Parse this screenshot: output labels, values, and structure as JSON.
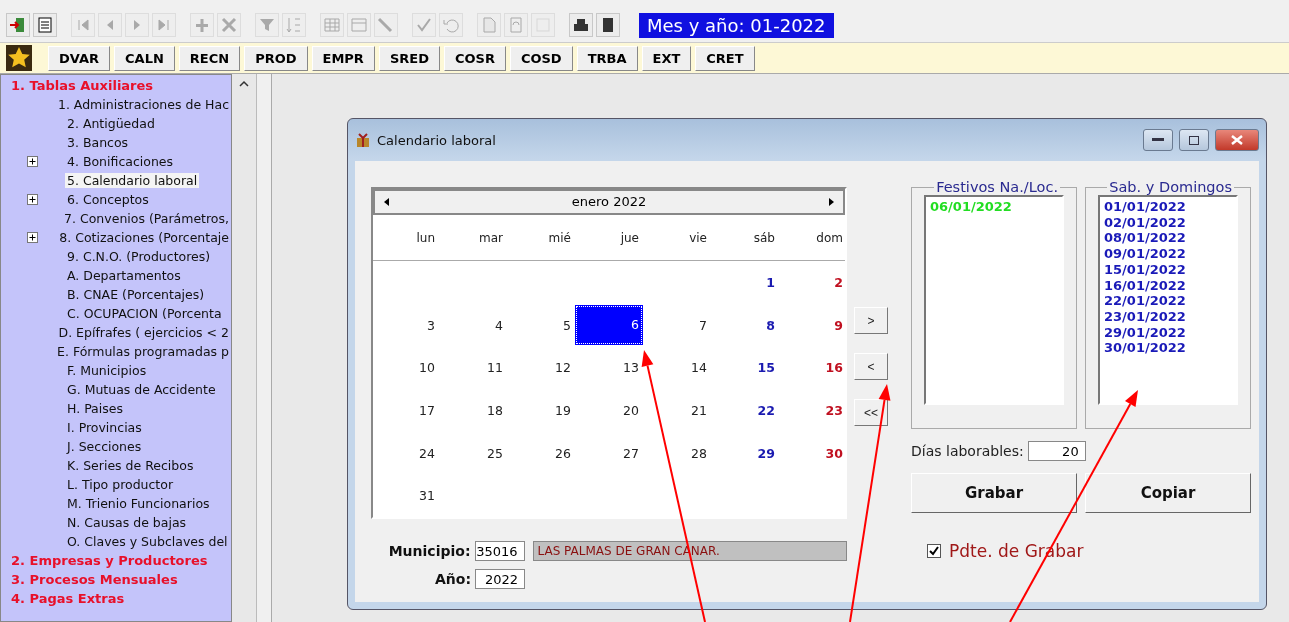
{
  "toolbar": {
    "icons": [
      {
        "kind": "exit",
        "disabled": false
      },
      {
        "kind": "properties",
        "disabled": false
      },
      {
        "kind": "first",
        "disabled": true
      },
      {
        "kind": "prev",
        "disabled": true
      },
      {
        "kind": "next",
        "disabled": true
      },
      {
        "kind": "last",
        "disabled": true
      },
      {
        "kind": "add",
        "disabled": true
      },
      {
        "kind": "delete",
        "disabled": true
      },
      {
        "kind": "filter",
        "disabled": true
      },
      {
        "kind": "sort",
        "disabled": true
      },
      {
        "kind": "grid",
        "disabled": true
      },
      {
        "kind": "form",
        "disabled": true
      },
      {
        "kind": "wand",
        "disabled": true
      },
      {
        "kind": "check",
        "disabled": true
      },
      {
        "kind": "undo",
        "disabled": true
      },
      {
        "kind": "doc",
        "disabled": true
      },
      {
        "kind": "refresh",
        "disabled": true
      },
      {
        "kind": "blank",
        "disabled": true
      },
      {
        "kind": "print",
        "disabled": false
      },
      {
        "kind": "page",
        "disabled": false
      }
    ],
    "period": "Mes y año: 01-2022"
  },
  "shortcuts": [
    "DVAR",
    "CALN",
    "RECN",
    "PROD",
    "EMPR",
    "SRED",
    "COSR",
    "COSD",
    "TRBA",
    "EXT",
    "CRET"
  ],
  "tree": [
    {
      "label": "1. Tablas Auxiliares",
      "children": [
        {
          "label": "1. Administraciones de Hac",
          "expandable": false,
          "selected": false
        },
        {
          "label": "2. Antigüedad",
          "expandable": false,
          "selected": false
        },
        {
          "label": "3. Bancos",
          "expandable": false,
          "selected": false
        },
        {
          "label": "4. Bonificaciones",
          "expandable": true,
          "selected": false
        },
        {
          "label": "5. Calendario laboral",
          "expandable": false,
          "selected": true
        },
        {
          "label": "6. Conceptos",
          "expandable": true,
          "selected": false
        },
        {
          "label": "7. Convenios (Parámetros,",
          "expandable": false,
          "selected": false
        },
        {
          "label": "8. Cotizaciones (Porcentaje",
          "expandable": true,
          "selected": false
        },
        {
          "label": "9. C.N.O. (Productores)",
          "expandable": false,
          "selected": false
        },
        {
          "label": "A. Departamentos",
          "expandable": false,
          "selected": false
        },
        {
          "label": "B. CNAE (Porcentajes)",
          "expandable": false,
          "selected": false
        },
        {
          "label": "C. OCUPACION (Porcenta",
          "expandable": false,
          "selected": false
        },
        {
          "label": "D. Epífrafes ( ejercicios < 2",
          "expandable": false,
          "selected": false
        },
        {
          "label": "E. Fórmulas programadas p",
          "expandable": false,
          "selected": false
        },
        {
          "label": "F. Municipios",
          "expandable": false,
          "selected": false
        },
        {
          "label": "G. Mutuas de Accidente",
          "expandable": false,
          "selected": false
        },
        {
          "label": "H. Paises",
          "expandable": false,
          "selected": false
        },
        {
          "label": "I. Provincias",
          "expandable": false,
          "selected": false
        },
        {
          "label": "J. Secciones",
          "expandable": false,
          "selected": false
        },
        {
          "label": "K. Series de Recibos",
          "expandable": false,
          "selected": false
        },
        {
          "label": "L. Tipo productor",
          "expandable": false,
          "selected": false
        },
        {
          "label": "M. Trienio Funcionarios",
          "expandable": false,
          "selected": false
        },
        {
          "label": "N. Causas de bajas",
          "expandable": false,
          "selected": false
        },
        {
          "label": "O. Claves y Subclaves del",
          "expandable": false,
          "selected": false
        }
      ]
    },
    {
      "label": "2. Empresas y Productores"
    },
    {
      "label": "3. Procesos Mensuales"
    },
    {
      "label": "4. Pagas Extras"
    }
  ],
  "dialog": {
    "title": "Calendario laboral",
    "calendar": {
      "month": "enero 2022",
      "weekdays": [
        "lun",
        "mar",
        "mié",
        "jue",
        "vie",
        "sáb",
        "dom"
      ],
      "weeks": [
        [
          {
            "kind": "blank"
          },
          {
            "kind": "blank"
          },
          {
            "kind": "blank"
          },
          {
            "kind": "blank"
          },
          {
            "kind": "blank"
          },
          {
            "day": "1",
            "kind": "saturday",
            "selected": false
          },
          {
            "day": "2",
            "kind": "sunday",
            "selected": false
          }
        ],
        [
          {
            "day": "3",
            "kind": "weekday",
            "selected": false
          },
          {
            "day": "4",
            "kind": "weekday",
            "selected": false
          },
          {
            "day": "5",
            "kind": "weekday",
            "selected": false
          },
          {
            "day": "6",
            "kind": "weekday",
            "selected": true
          },
          {
            "day": "7",
            "kind": "weekday",
            "selected": false
          },
          {
            "day": "8",
            "kind": "saturday",
            "selected": false
          },
          {
            "day": "9",
            "kind": "sunday",
            "selected": false
          }
        ],
        [
          {
            "day": "10",
            "kind": "weekday",
            "selected": false
          },
          {
            "day": "11",
            "kind": "weekday",
            "selected": false
          },
          {
            "day": "12",
            "kind": "weekday",
            "selected": false
          },
          {
            "day": "13",
            "kind": "weekday",
            "selected": false
          },
          {
            "day": "14",
            "kind": "weekday",
            "selected": false
          },
          {
            "day": "15",
            "kind": "saturday",
            "selected": false
          },
          {
            "day": "16",
            "kind": "sunday",
            "selected": false
          }
        ],
        [
          {
            "day": "17",
            "kind": "weekday",
            "selected": false
          },
          {
            "day": "18",
            "kind": "weekday",
            "selected": false
          },
          {
            "day": "19",
            "kind": "weekday",
            "selected": false
          },
          {
            "day": "20",
            "kind": "weekday",
            "selected": false
          },
          {
            "day": "21",
            "kind": "weekday",
            "selected": false
          },
          {
            "day": "22",
            "kind": "saturday",
            "selected": false
          },
          {
            "day": "23",
            "kind": "sunday",
            "selected": false
          }
        ],
        [
          {
            "day": "24",
            "kind": "weekday",
            "selected": false
          },
          {
            "day": "25",
            "kind": "weekday",
            "selected": false
          },
          {
            "day": "26",
            "kind": "weekday",
            "selected": false
          },
          {
            "day": "27",
            "kind": "weekday",
            "selected": false
          },
          {
            "day": "28",
            "kind": "weekday",
            "selected": false
          },
          {
            "day": "29",
            "kind": "saturday",
            "selected": false
          },
          {
            "day": "30",
            "kind": "sunday",
            "selected": false
          }
        ],
        [
          {
            "day": "31",
            "kind": "weekday",
            "selected": false
          },
          {
            "kind": "blank"
          },
          {
            "kind": "blank"
          },
          {
            "kind": "blank"
          },
          {
            "kind": "blank"
          },
          {
            "kind": "blank"
          },
          {
            "kind": "blank"
          }
        ]
      ]
    },
    "move_buttons": [
      ">",
      "<",
      "<<"
    ],
    "holidays": {
      "title": "Festivos Na./Loc.",
      "items": [
        "06/01/2022"
      ]
    },
    "weekends": {
      "title": "Sab. y Domingos",
      "items": [
        "01/01/2022",
        "02/01/2022",
        "08/01/2022",
        "09/01/2022",
        "15/01/2022",
        "16/01/2022",
        "22/01/2022",
        "23/01/2022",
        "29/01/2022",
        "30/01/2022"
      ]
    },
    "working_days": {
      "label": "Días laborables:",
      "value": "20"
    },
    "buttons": [
      "Grabar",
      "Copiar"
    ],
    "pending": {
      "label": "Pdte. de Grabar",
      "checked": true
    },
    "municipio": {
      "label": "Municipio:",
      "code": "35016",
      "name": "LAS PALMAS DE GRAN CANAR."
    },
    "year": {
      "label": "Año:",
      "value": "2022"
    }
  },
  "annotations": [
    {
      "kind": "arrow"
    },
    {
      "kind": "arrow"
    },
    {
      "kind": "arrow"
    }
  ]
}
